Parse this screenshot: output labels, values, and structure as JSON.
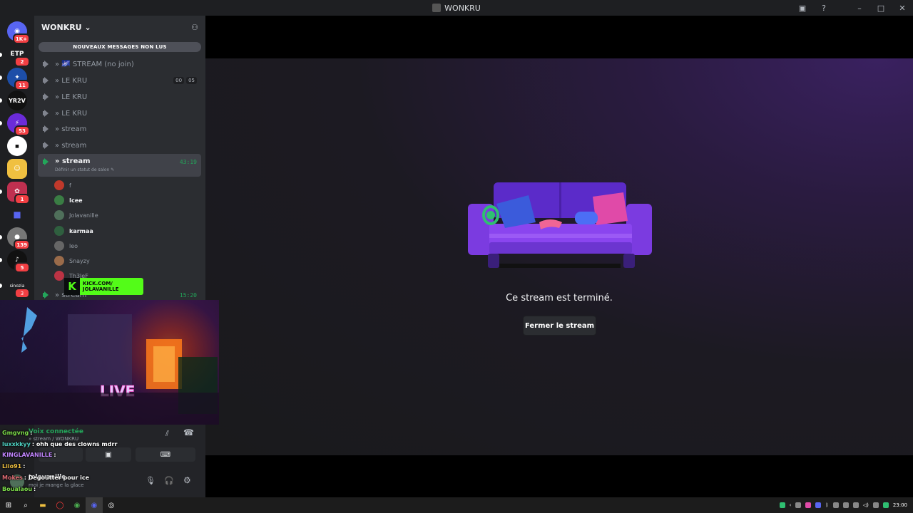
{
  "window": {
    "title": "WONKRU"
  },
  "servers": [
    {
      "label": "",
      "badge": "1K+",
      "color": "#5865f2"
    },
    {
      "label": "ETP",
      "badge": "2",
      "color": "#1e1f22"
    },
    {
      "label": "",
      "badge": "11",
      "color": "#1d4ea8"
    },
    {
      "label": "YR2V",
      "badge": "",
      "color": "#111"
    },
    {
      "label": "",
      "badge": "53",
      "color": "#6b2bd9"
    },
    {
      "label": "",
      "badge": "",
      "color": "#ffffff"
    },
    {
      "label": "",
      "badge": "",
      "color": "#f0c040"
    },
    {
      "label": "",
      "badge": "1",
      "color": "#c03050"
    },
    {
      "label": "",
      "badge": "",
      "color": "#5865f2"
    },
    {
      "label": "",
      "badge": "139",
      "color": "#777"
    },
    {
      "label": "",
      "badge": "5",
      "color": "#111"
    },
    {
      "label": "sinozia",
      "badge": "3",
      "color": "#1e1f22"
    }
  ],
  "sidebar": {
    "guild_name": "WONKRU",
    "new_messages": "NOUVEAUX MESSAGES NON LUS",
    "channels": [
      {
        "name": "» 🌌 STREAM (no join)"
      },
      {
        "name": "» LE KRU",
        "counts": [
          "00",
          "05"
        ]
      },
      {
        "name": "» LE KRU"
      },
      {
        "name": "» LE KRU"
      },
      {
        "name": "» stream"
      },
      {
        "name": "» stream"
      }
    ],
    "active_channel": {
      "name": "» stream",
      "time": "43:19",
      "status_hint": "Définir un statut de salon"
    },
    "users": [
      {
        "name": "f",
        "bright": false,
        "color": "#c0392b"
      },
      {
        "name": "Icee",
        "bright": true,
        "color": "#3a7d44"
      },
      {
        "name": "Jolavanille",
        "bright": false,
        "color": "#4f6f5a"
      },
      {
        "name": "karmaa",
        "bright": true,
        "color": "#2f5f3f"
      },
      {
        "name": "leo",
        "bright": false,
        "color": "#666"
      },
      {
        "name": "Snayzy",
        "bright": false,
        "color": "#9a6b4a"
      },
      {
        "name": "Th3leF",
        "bright": false,
        "color": "#bb3344"
      }
    ],
    "last_channel": {
      "name": "» stream",
      "time": "15:20"
    }
  },
  "stage": {
    "message": "Ce stream est terminé.",
    "close_label": "Fermer le stream"
  },
  "kick": {
    "line1": "KICK.COM/",
    "line2": "JOLAVANILLE",
    "letter": "K"
  },
  "voice": {
    "status": "Voix connectée",
    "subtitle": "» stream / WONKRU",
    "username": "Jolavanille",
    "user_status": "moi je mange la glace"
  },
  "chat": [
    {
      "name": "Gmgvng",
      "color": "#7ddc4a",
      "text": ":"
    },
    {
      "name": "luxxkkyy",
      "color": "#4fd3c4",
      "text": ": ohh que des clowns mdrr"
    },
    {
      "name": "KINGLAVANILLE",
      "color": "#c084fc",
      "text": ":"
    },
    {
      "name": "Liio91",
      "color": "#f0c040",
      "text": ":"
    },
    {
      "name": "Mokes",
      "color": "#e06c75",
      "text": ": Degoutter pour ice"
    },
    {
      "name": "Boualaou",
      "color": "#7ddc4a",
      "text": ":"
    }
  ],
  "taskbar": {
    "clock": "23:00"
  }
}
